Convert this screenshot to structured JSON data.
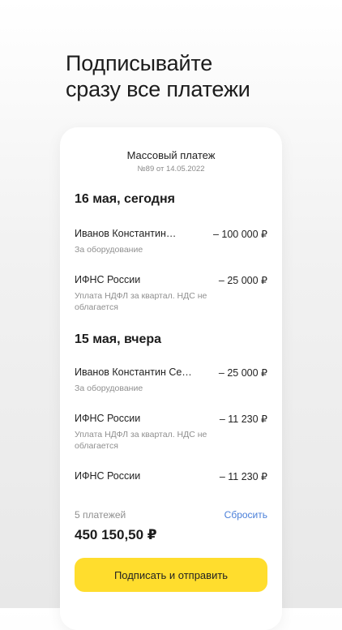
{
  "headline": [
    "Подписывайте",
    "сразу все платежи"
  ],
  "card": {
    "title": "Массовый платеж",
    "subtitle": "№89 от 14.05.2022"
  },
  "groups": [
    {
      "day": "16 мая, сегодня",
      "items": [
        {
          "name": "Иванов Константин…",
          "amount": "– 100 000 ₽",
          "desc": "За оборудование"
        },
        {
          "name": "ИФНС России",
          "amount": "– 25 000 ₽",
          "desc": "Уплата НДФЛ за квартал. НДС не облагается"
        }
      ]
    },
    {
      "day": "15 мая, вчера",
      "items": [
        {
          "name": "Иванов Константин Се…",
          "amount": "– 25 000 ₽",
          "desc": "За оборудование"
        },
        {
          "name": "ИФНС России",
          "amount": "– 11 230 ₽",
          "desc": "Уплата НДФЛ за квартал. НДС не облагается"
        },
        {
          "name": "ИФНС России",
          "amount": "– 11 230 ₽",
          "desc": ""
        }
      ]
    }
  ],
  "footer": {
    "count": "5 платежей",
    "reset": "Сбросить",
    "total": "450 150,50 ₽",
    "button": "Подписать и отправить"
  }
}
